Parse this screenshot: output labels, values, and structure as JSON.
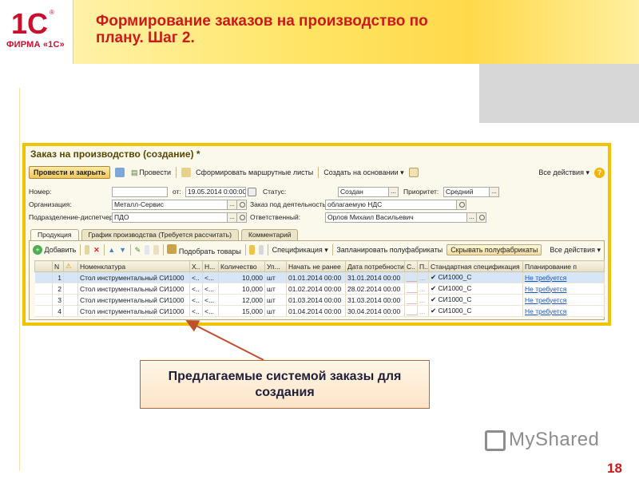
{
  "slide": {
    "logo_text": "1С",
    "logo_reg": "®",
    "firm": "ФИРМА «1С»",
    "title": "Формирование заказов на производство по плану. Шаг 2.",
    "callout": "Предлагаемые системой заказы для создания",
    "brand": "MyShared",
    "page_number": "18"
  },
  "form": {
    "title": "Заказ на производство (создание) *",
    "toolbar": {
      "post_close": "Провести и закрыть",
      "post": "Провести",
      "routes": "Сформировать маршрутные листы",
      "create_based": "Создать на основании",
      "all_actions": "Все действия"
    },
    "fields": {
      "number_label": "Номер:",
      "number_value": "",
      "from_label": "от:",
      "date_value": "19.05.2014 0:00:00",
      "status_label": "Статус:",
      "status_value": "Создан",
      "priority_label": "Приоритет:",
      "priority_value": "Средний",
      "org_label": "Организация:",
      "org_value": "Металл-Сервис",
      "activity_label": "Заказ под деятельность:",
      "activity_value": "облагаемую НДС",
      "dept_label": "Подразделение-диспетчер:",
      "dept_value": "ПДО",
      "resp_label": "Ответственный:",
      "resp_value": "Орлов Михаил Васильевич"
    },
    "tabs": [
      "Продукция",
      "График производства (Требуется рассчитать)",
      "Комментарий"
    ],
    "products_toolbar": {
      "add": "Добавить",
      "pick": "Подобрать товары",
      "spec": "Спецификация",
      "plan_semi": "Запланировать полуфабрикаты",
      "hide_semi": "Скрывать полуфабрикаты",
      "all_actions": "Все действия"
    },
    "table": {
      "columns": [
        "N",
        "",
        "Номенклатура",
        "Х..",
        "Н...",
        "Количество",
        "Уп...",
        "Начать не ранее",
        "Дата потребности",
        "С..",
        "П..",
        "Стандартная спецификация",
        "Планирование п"
      ],
      "rows": [
        {
          "n": "1",
          "item": "Стол инструментальный СИ1000",
          "x": "<..",
          "h": "<...",
          "qty": "10,000",
          "unit": "шт",
          "start": "01.01.2014 00:00",
          "need": "31.01.2014 00:00",
          "s": "___",
          "p": "...",
          "spec": "✔ СИ1000_С",
          "plan": "Не требуется"
        },
        {
          "n": "2",
          "item": "Стол инструментальный СИ1000",
          "x": "<..",
          "h": "<...",
          "qty": "10,000",
          "unit": "шт",
          "start": "01.02.2014 00:00",
          "need": "28.02.2014 00:00",
          "s": "___",
          "p": "...",
          "spec": "✔ СИ1000_С",
          "plan": "Не требуется"
        },
        {
          "n": "3",
          "item": "Стол инструментальный СИ1000",
          "x": "<..",
          "h": "<...",
          "qty": "12,000",
          "unit": "шт",
          "start": "01.03.2014 00:00",
          "need": "31.03.2014 00:00",
          "s": "___",
          "p": "...",
          "spec": "✔ СИ1000_С",
          "plan": "Не требуется"
        },
        {
          "n": "4",
          "item": "Стол инструментальный СИ1000",
          "x": "<..",
          "h": "<...",
          "qty": "15,000",
          "unit": "шт",
          "start": "01.04.2014 00:00",
          "need": "30.04.2014 00:00",
          "s": "___",
          "p": "...",
          "spec": "✔ СИ1000_С",
          "plan": "Не требуется"
        }
      ]
    }
  },
  "colors": {
    "title_red": "#cc1a1a",
    "frame_yellow": "#f0c300",
    "selection_blue": "#d6e6f7",
    "link_blue": "#1a56c2"
  }
}
